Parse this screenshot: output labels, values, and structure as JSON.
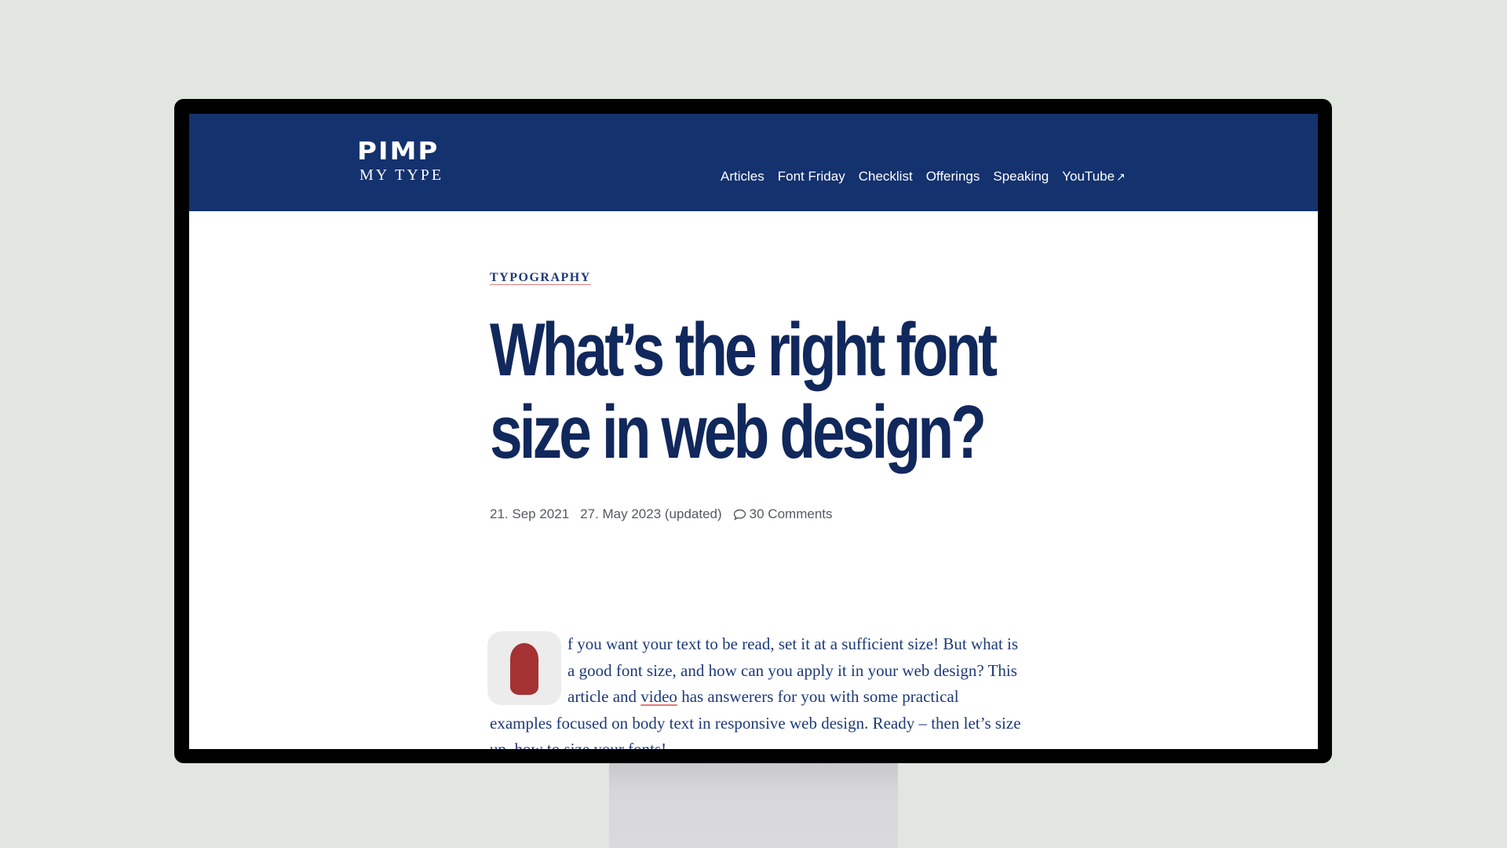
{
  "site": {
    "logo_top": "PIMP",
    "logo_bottom": "MY TYPE",
    "colors": {
      "header_bg": "#14326e",
      "text_navy": "#11285c",
      "accent_red": "#a43232",
      "underline": "#e07b7b"
    }
  },
  "nav": {
    "items": [
      {
        "label": "Articles"
      },
      {
        "label": "Font Friday"
      },
      {
        "label": "Checklist"
      },
      {
        "label": "Offerings"
      },
      {
        "label": "Speaking"
      },
      {
        "label": "YouTube",
        "external_icon": "↗"
      }
    ]
  },
  "article": {
    "category": "TYPOGRAPHY",
    "title_line1": "What’s the right font",
    "title_line2": "size in web design?",
    "published": "21. Sep 2021",
    "updated": "27. May 2023 (updated)",
    "comments": "30 Comments",
    "comment_icon": "speech-bubble",
    "dropcap": "I",
    "intro_part1": "f you want your text to be read, set it at a sufficient size! But what is a good font size, and how can you apply it in your web design? This article and ",
    "intro_link": "video",
    "intro_part2": " has answerers for you with some practical examples focused on body text in responsive web design. Ready – then let’s size up, how to size your fonts!"
  }
}
